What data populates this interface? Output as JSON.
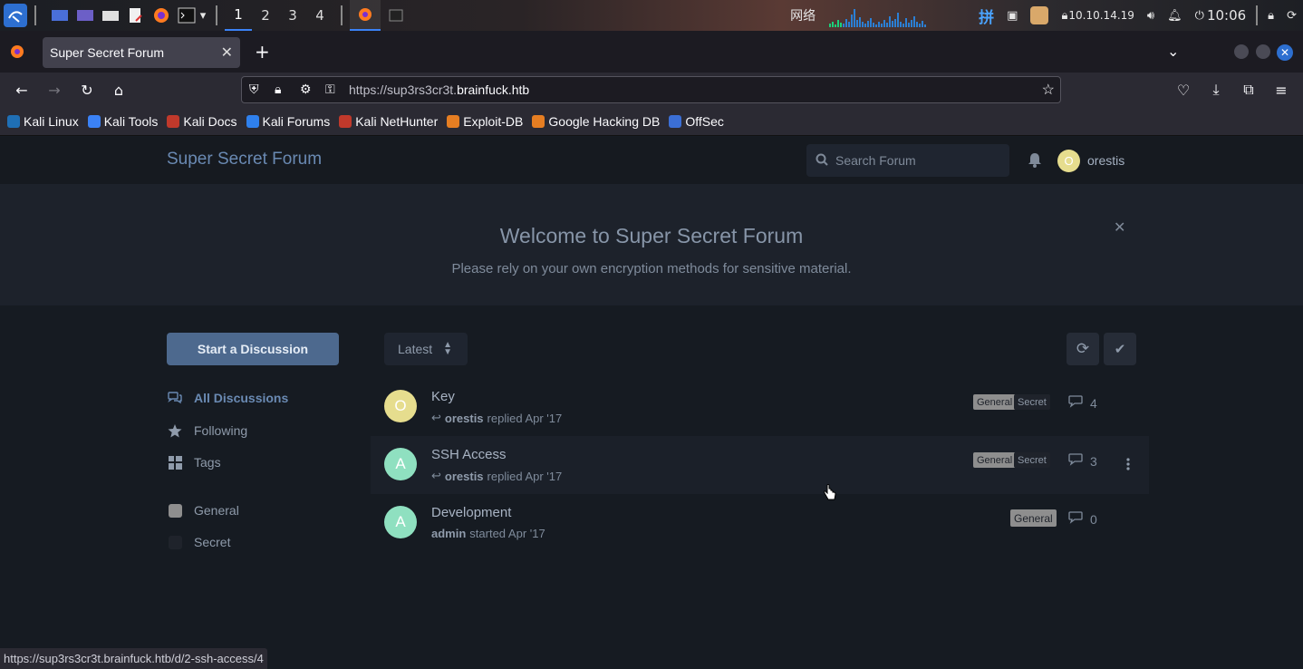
{
  "system_bar": {
    "workspaces": [
      "1",
      "2",
      "3",
      "4"
    ],
    "network_label": "网络",
    "input_method": "拼",
    "ip_address": "10.10.14.19",
    "clock": "10:06"
  },
  "browser": {
    "tab_title": "Super Secret Forum",
    "url_prefix": "https://sup3rs3cr3t.",
    "url_domain": "brainfuck.htb",
    "bookmarks": [
      {
        "label": "Kali Linux",
        "color": "#1f6fb5"
      },
      {
        "label": "Kali Tools",
        "color": "#3b82f6"
      },
      {
        "label": "Kali Docs",
        "color": "#c0392b"
      },
      {
        "label": "Kali Forums",
        "color": "#2f80ed"
      },
      {
        "label": "Kali NetHunter",
        "color": "#c0392b"
      },
      {
        "label": "Exploit-DB",
        "color": "#e67e22"
      },
      {
        "label": "Google Hacking DB",
        "color": "#e67e22"
      },
      {
        "label": "OffSec",
        "color": "#3b6fd6"
      }
    ],
    "status_url": "https://sup3rs3cr3t.brainfuck.htb/d/2-ssh-access/4"
  },
  "forum": {
    "title": "Super Secret Forum",
    "search_placeholder": "Search Forum",
    "user": {
      "initial": "O",
      "name": "orestis",
      "color": "#e6dd8e"
    },
    "hero": {
      "title": "Welcome to Super Secret Forum",
      "subtitle": "Please rely on your own encryption methods for sensitive material."
    },
    "start_button": "Start a Discussion",
    "nav": {
      "all_discussions": "All Discussions",
      "following": "Following",
      "tags": "Tags"
    },
    "tags": [
      {
        "label": "General",
        "color": "#8e8e8e"
      },
      {
        "label": "Secret",
        "color": "#1f232b"
      }
    ],
    "sort_label": "Latest",
    "discussions": [
      {
        "title": "Key",
        "initial": "O",
        "avatar_color": "#e6dd8e",
        "user": "orestis",
        "action": "replied Apr '17",
        "tags": [
          "General",
          "Secret"
        ],
        "replies": "4",
        "replied": true
      },
      {
        "title": "SSH Access",
        "initial": "A",
        "avatar_color": "#8fe0c0",
        "user": "orestis",
        "action": "replied Apr '17",
        "tags": [
          "General",
          "Secret"
        ],
        "replies": "3",
        "replied": true
      },
      {
        "title": "Development",
        "initial": "A",
        "avatar_color": "#8fe0c0",
        "user": "admin",
        "action": "started Apr '17",
        "tags": [
          "General"
        ],
        "replies": "0",
        "replied": false
      }
    ]
  }
}
